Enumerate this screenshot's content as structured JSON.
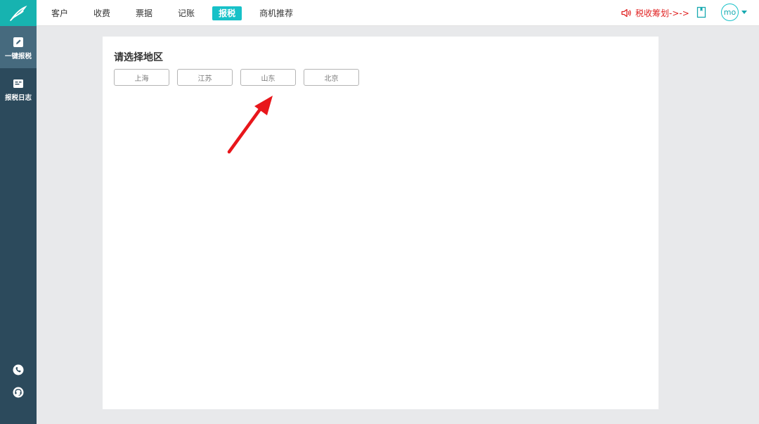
{
  "nav": {
    "items": [
      {
        "label": "客户"
      },
      {
        "label": "收费"
      },
      {
        "label": "票据"
      },
      {
        "label": "记账"
      },
      {
        "label": "报税",
        "active": true
      },
      {
        "label": "商机推荐"
      }
    ]
  },
  "header": {
    "tax_plan_label": "税收筹划->->",
    "avatar_text": "mo"
  },
  "sidebar": {
    "items": [
      {
        "label": "一键报税",
        "icon": "edit-icon",
        "active": true
      },
      {
        "label": "报税日志",
        "icon": "log-icon"
      }
    ],
    "bottom_icons": [
      "phone-icon",
      "support-icon"
    ]
  },
  "main": {
    "title": "请选择地区",
    "regions": [
      {
        "label": "上海"
      },
      {
        "label": "江苏"
      },
      {
        "label": "山东"
      },
      {
        "label": "北京"
      }
    ]
  },
  "colors": {
    "accent": "#17c1c8",
    "logo_bg": "#17b3b0",
    "sidebar_bg": "#2c4a5c",
    "sidebar_active": "#466a7e",
    "alert_red": "#e02222",
    "annotation_arrow": "#e8161b"
  }
}
